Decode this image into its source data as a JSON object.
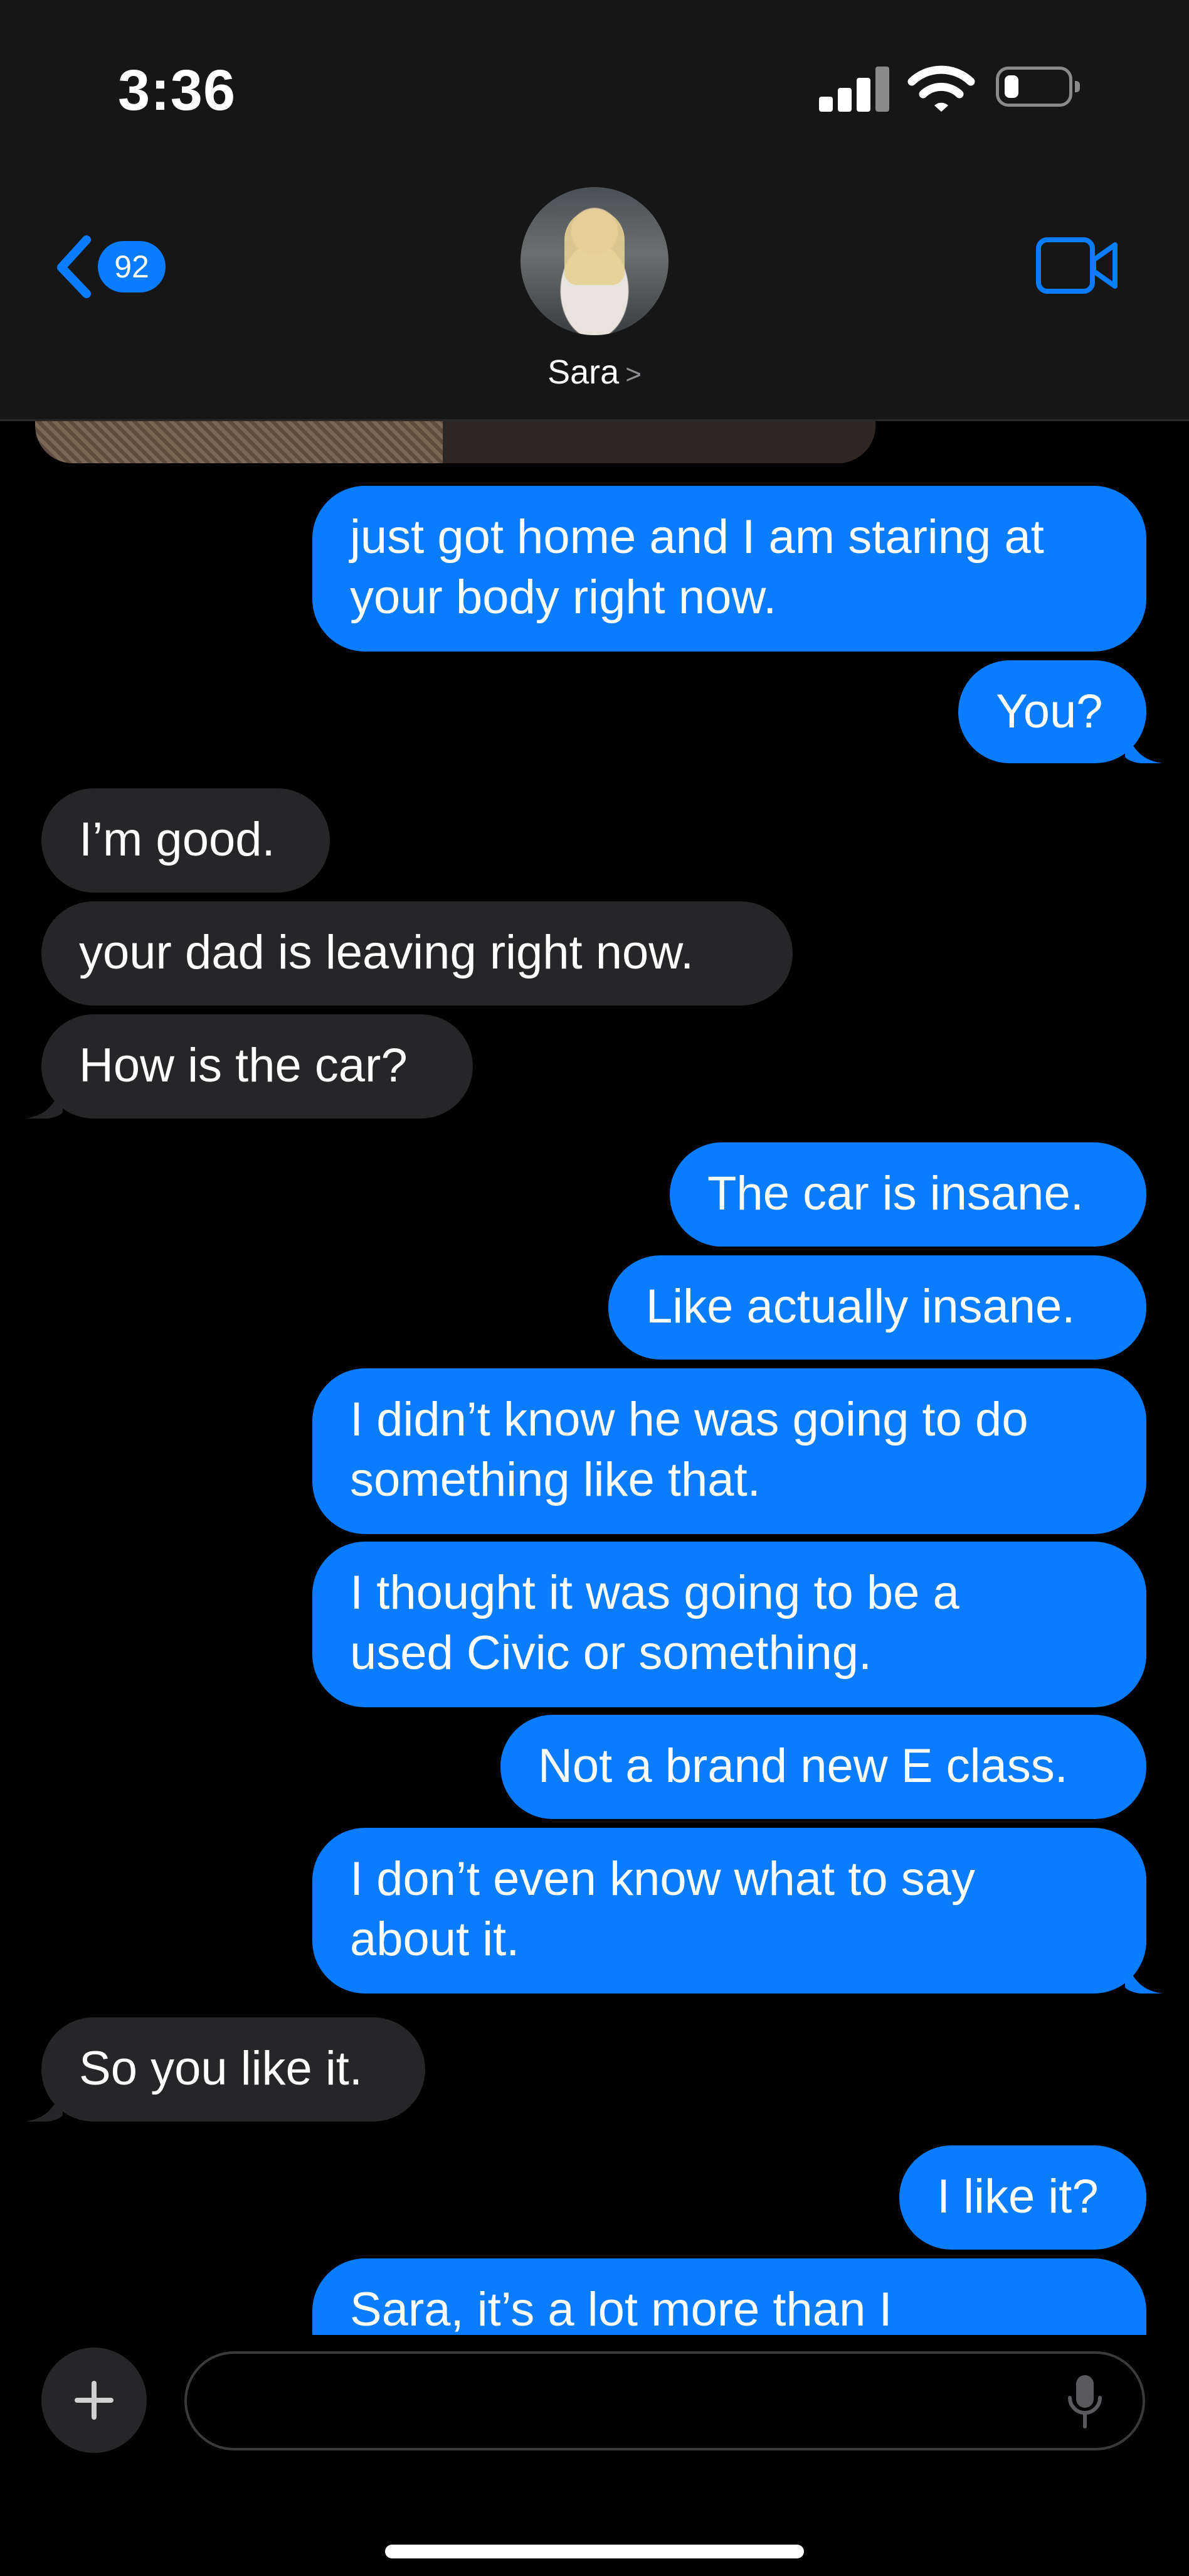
{
  "status_bar": {
    "time": "3:36"
  },
  "header": {
    "back_badge": "92",
    "contact_name": "Sara",
    "contact_chevron": ">"
  },
  "messages": [
    {
      "from": "me",
      "text": "just got home and I am staring at\nyour body right now."
    },
    {
      "from": "me",
      "text": "You?"
    },
    {
      "from": "them",
      "text": "I’m good."
    },
    {
      "from": "them",
      "text": "your dad is leaving right now."
    },
    {
      "from": "them",
      "text": "How is the car?"
    },
    {
      "from": "me",
      "text": "The car is insane."
    },
    {
      "from": "me",
      "text": "Like actually insane."
    },
    {
      "from": "me",
      "text": "I didn’t know he was going to do\nsomething like that."
    },
    {
      "from": "me",
      "text": "I thought it was going to be a\nused Civic or something."
    },
    {
      "from": "me",
      "text": "Not a brand new E class."
    },
    {
      "from": "me",
      "text": "I don’t even know what to say\nabout it."
    },
    {
      "from": "them",
      "text": "So you like it."
    },
    {
      "from": "me",
      "text": "I like it?"
    },
    {
      "from": "me",
      "text": "Sara, it’s a lot more than I"
    }
  ],
  "composer": {
    "placeholder": ""
  },
  "colors": {
    "outgoing": "#0a7cff",
    "incoming": "#262628",
    "accent": "#0a7cff"
  }
}
